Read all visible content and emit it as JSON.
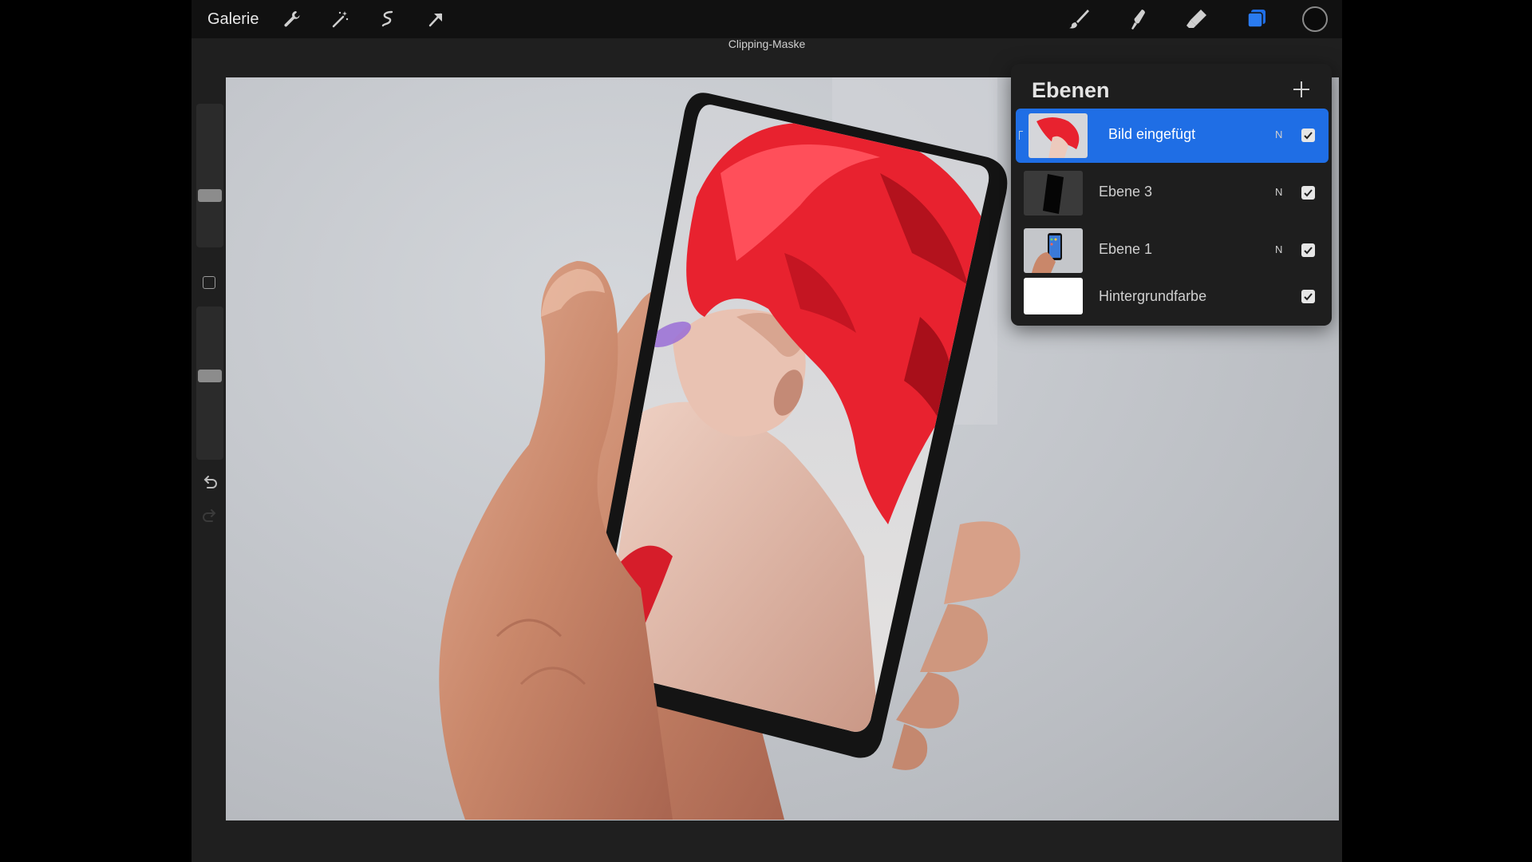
{
  "topbar": {
    "gallery_label": "Galerie",
    "left_tools": [
      {
        "icon": "wrench-icon"
      },
      {
        "icon": "magic-wand-icon"
      },
      {
        "icon": "selection-icon"
      },
      {
        "icon": "transform-arrow-icon"
      }
    ],
    "right_tools": [
      {
        "icon": "brush-icon"
      },
      {
        "icon": "smudge-icon"
      },
      {
        "icon": "eraser-icon"
      },
      {
        "icon": "layers-icon",
        "active": true
      },
      {
        "icon": "color-swatch-icon"
      }
    ],
    "accent_color": "#1f6ee5"
  },
  "status_label": "Clipping-Maske",
  "sidebar": {
    "brush_size_level": 0.35,
    "opacity_level": 0.55,
    "icons": [
      "modify-square-icon",
      "undo-icon",
      "redo-icon"
    ]
  },
  "layers_panel": {
    "title": "Ebenen",
    "add_icon": "plus-icon",
    "layers": [
      {
        "name": "Bild eingefügt",
        "blend": "N",
        "visible": true,
        "active": true,
        "clipped": true
      },
      {
        "name": "Ebene 3",
        "blend": "N",
        "visible": true,
        "active": false
      },
      {
        "name": "Ebene 1",
        "blend": "N",
        "visible": true,
        "active": false
      },
      {
        "name": "Hintergrundfarbe",
        "blend": "",
        "visible": true,
        "active": false
      }
    ]
  },
  "colors": {
    "background_color_layer": "#ffffff",
    "hair_color": "#e8222f"
  }
}
